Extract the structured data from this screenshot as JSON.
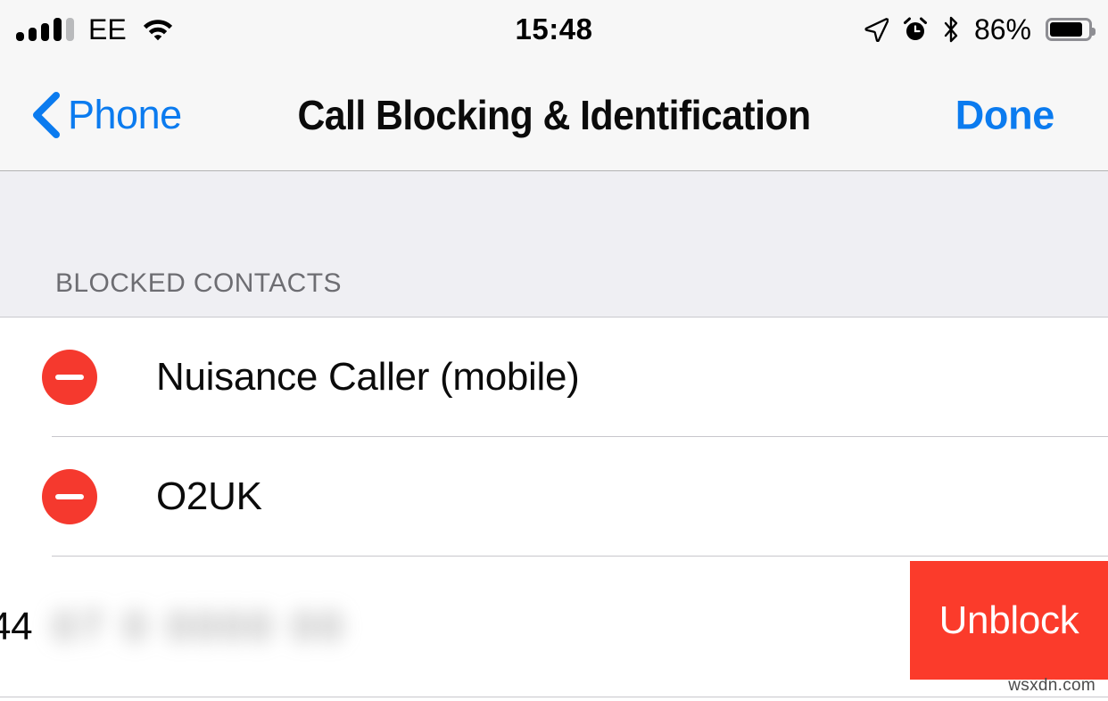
{
  "status_bar": {
    "carrier": "EE",
    "time": "15:48",
    "battery_percent": "86%",
    "signal_icon": "cellular-signal-icon",
    "wifi_icon": "wifi-icon",
    "location_icon": "location-arrow-icon",
    "alarm_icon": "alarm-clock-icon",
    "bluetooth_icon": "bluetooth-icon",
    "battery_icon": "battery-icon",
    "signal_bars_total": 5,
    "signal_bars_filled": 4,
    "battery_fill_percent": 86
  },
  "nav_bar": {
    "back_label": "Phone",
    "back_icon": "chevron-left-icon",
    "title": "Call Blocking & Identification",
    "done_label": "Done"
  },
  "section": {
    "header": "BLOCKED CONTACTS"
  },
  "rows": [
    {
      "label": "Nuisance Caller (mobile)",
      "delete_icon": "minus-circle-icon",
      "state": "normal"
    },
    {
      "label": "O2UK",
      "delete_icon": "minus-circle-icon",
      "state": "normal"
    }
  ],
  "swiped_row": {
    "visible_prefix": "44",
    "redacted_number": "07 0 0000 00",
    "unblock_label": "Unblock",
    "state": "swiped-open"
  },
  "watermark": {
    "text": "wsxdn.com"
  },
  "colors": {
    "ios_blue": "#0B7BEF",
    "destructive_red": "#F5392E",
    "unblock_red": "#FB3B2B",
    "bar_background": "#F7F7F7",
    "group_background": "#EFEFF3",
    "separator": "#C8C7CC",
    "secondary_text": "#6D6D72"
  }
}
